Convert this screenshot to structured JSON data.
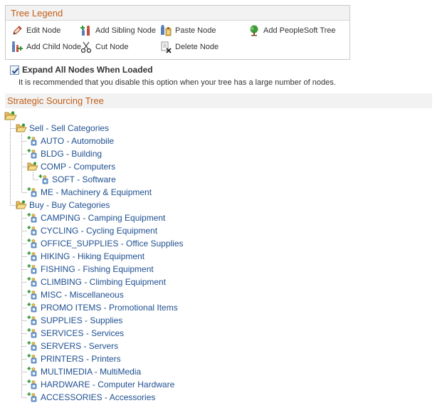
{
  "legend": {
    "title": "Tree Legend",
    "items": [
      {
        "label": "Edit Node",
        "icon": "pencil-icon"
      },
      {
        "label": "Add Sibling Node",
        "icon": "add-sibling-icon"
      },
      {
        "label": "Paste Node",
        "icon": "paste-icon"
      },
      {
        "label": "Add PeopleSoft Tree",
        "icon": "tree-icon"
      },
      {
        "label": "Add Child Node",
        "icon": "add-child-icon"
      },
      {
        "label": "Cut Node",
        "icon": "scissors-icon"
      },
      {
        "label": "Delete Node",
        "icon": "delete-icon"
      }
    ]
  },
  "options": {
    "expand_label": "Expand All Nodes When Loaded",
    "expand_checked": true,
    "hint": "It is recommended that you disable this option when your tree has a large number of nodes."
  },
  "tree": {
    "title": "Strategic Sourcing Tree",
    "nodes": [
      {
        "label": "Sell - Sell Categories",
        "type": "folder-open"
      },
      {
        "label": "AUTO - Automobile",
        "type": "leaf"
      },
      {
        "label": "BLDG - Building",
        "type": "leaf"
      },
      {
        "label": "COMP - Computers",
        "type": "folder-open"
      },
      {
        "label": "SOFT - Software",
        "type": "leaf"
      },
      {
        "label": "ME - Machinery & Equipment",
        "type": "leaf"
      },
      {
        "label": "Buy - Buy Categories",
        "type": "folder-open"
      },
      {
        "label": "CAMPING - Camping Equipment",
        "type": "leaf"
      },
      {
        "label": "CYCLING - Cycling Equipment",
        "type": "leaf"
      },
      {
        "label": "OFFICE_SUPPLIES - Office Supplies",
        "type": "leaf"
      },
      {
        "label": "HIKING - Hiking Equipment",
        "type": "leaf"
      },
      {
        "label": "FISHING - Fishing Equipment",
        "type": "leaf"
      },
      {
        "label": "CLIMBING - Climbing Equipment",
        "type": "leaf"
      },
      {
        "label": "MISC - Miscellaneous",
        "type": "leaf"
      },
      {
        "label": "PROMO ITEMS - Promotional Items",
        "type": "leaf"
      },
      {
        "label": "SUPPLIES - Supplies",
        "type": "leaf"
      },
      {
        "label": "SERVICES - Services",
        "type": "leaf"
      },
      {
        "label": "SERVERS - Servers",
        "type": "leaf"
      },
      {
        "label": "PRINTERS - Printers",
        "type": "leaf"
      },
      {
        "label": "MULTIMEDIA - MultiMedia",
        "type": "leaf"
      },
      {
        "label": "HARDWARE - Computer Hardware",
        "type": "leaf"
      },
      {
        "label": "ACCESSORIES - Accessories",
        "type": "leaf"
      }
    ]
  },
  "colors": {
    "header_text": "#c25e17",
    "link": "#1f4f90",
    "plus_green": "#2e9a2e",
    "folder": "#e9c25c"
  }
}
